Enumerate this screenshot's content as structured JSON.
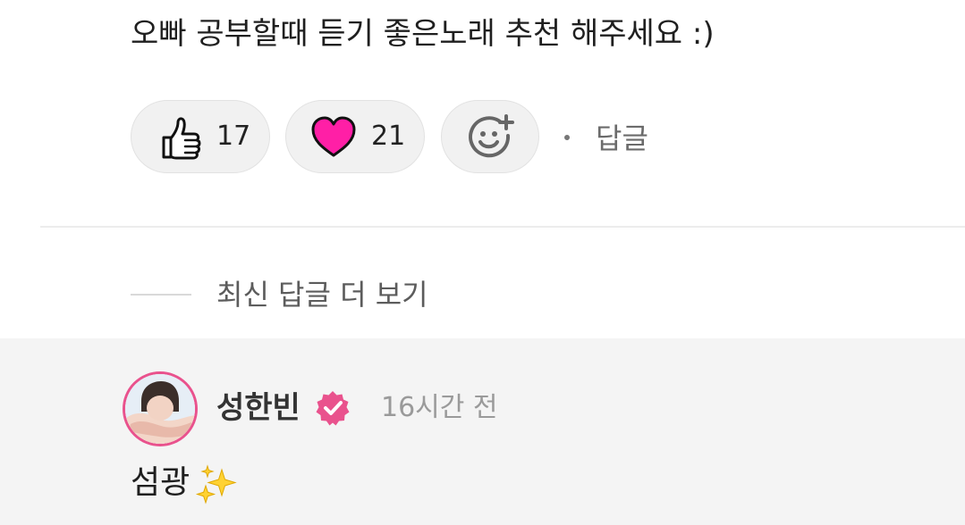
{
  "comment": {
    "text": "오빠 공부할때 듣기 좋은노래 추천 해주세요 :)",
    "reactions": {
      "like_count": "17",
      "heart_count": "21"
    },
    "reply_label": "답글"
  },
  "more_replies_label": "최신 답글 더 보기",
  "reply": {
    "author": "성한빈",
    "time": "16시간 전",
    "text": "섬광",
    "emoji": "sparkles-icon"
  },
  "colors": {
    "heart": "#ff1fa6",
    "verified_badge": "#e9528d",
    "avatar_border": "#e9528d",
    "reply_background": "#f4f4f4",
    "pill_background": "#f1f1f1"
  }
}
